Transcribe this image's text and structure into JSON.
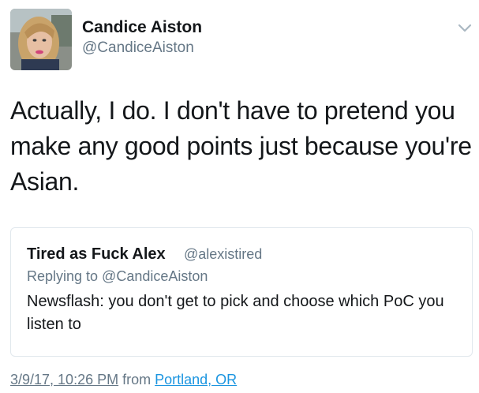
{
  "author": {
    "name": "Candice Aiston",
    "handle": "@CandiceAiston",
    "avatar_icon": "profile-photo"
  },
  "tweet": {
    "text": "Actually, I do. I don't have to pretend you make any good points just because you're Asian."
  },
  "quoted_tweet": {
    "name": "Tired as Fuck Alex",
    "handle": "@alexistired",
    "replying_to": "Replying to @CandiceAiston",
    "text": "Newsflash: you don't get to pick and choose which PoC you listen to"
  },
  "meta": {
    "timestamp": "3/9/17, 10:26 PM",
    "from_label": "from",
    "location": "Portland, OR"
  },
  "menu": {
    "icon": "chevron-down-icon"
  },
  "colors": {
    "primary_text": "#14171a",
    "secondary_text": "#657786",
    "link": "#1b95e0",
    "border": "#e1e8ed"
  }
}
